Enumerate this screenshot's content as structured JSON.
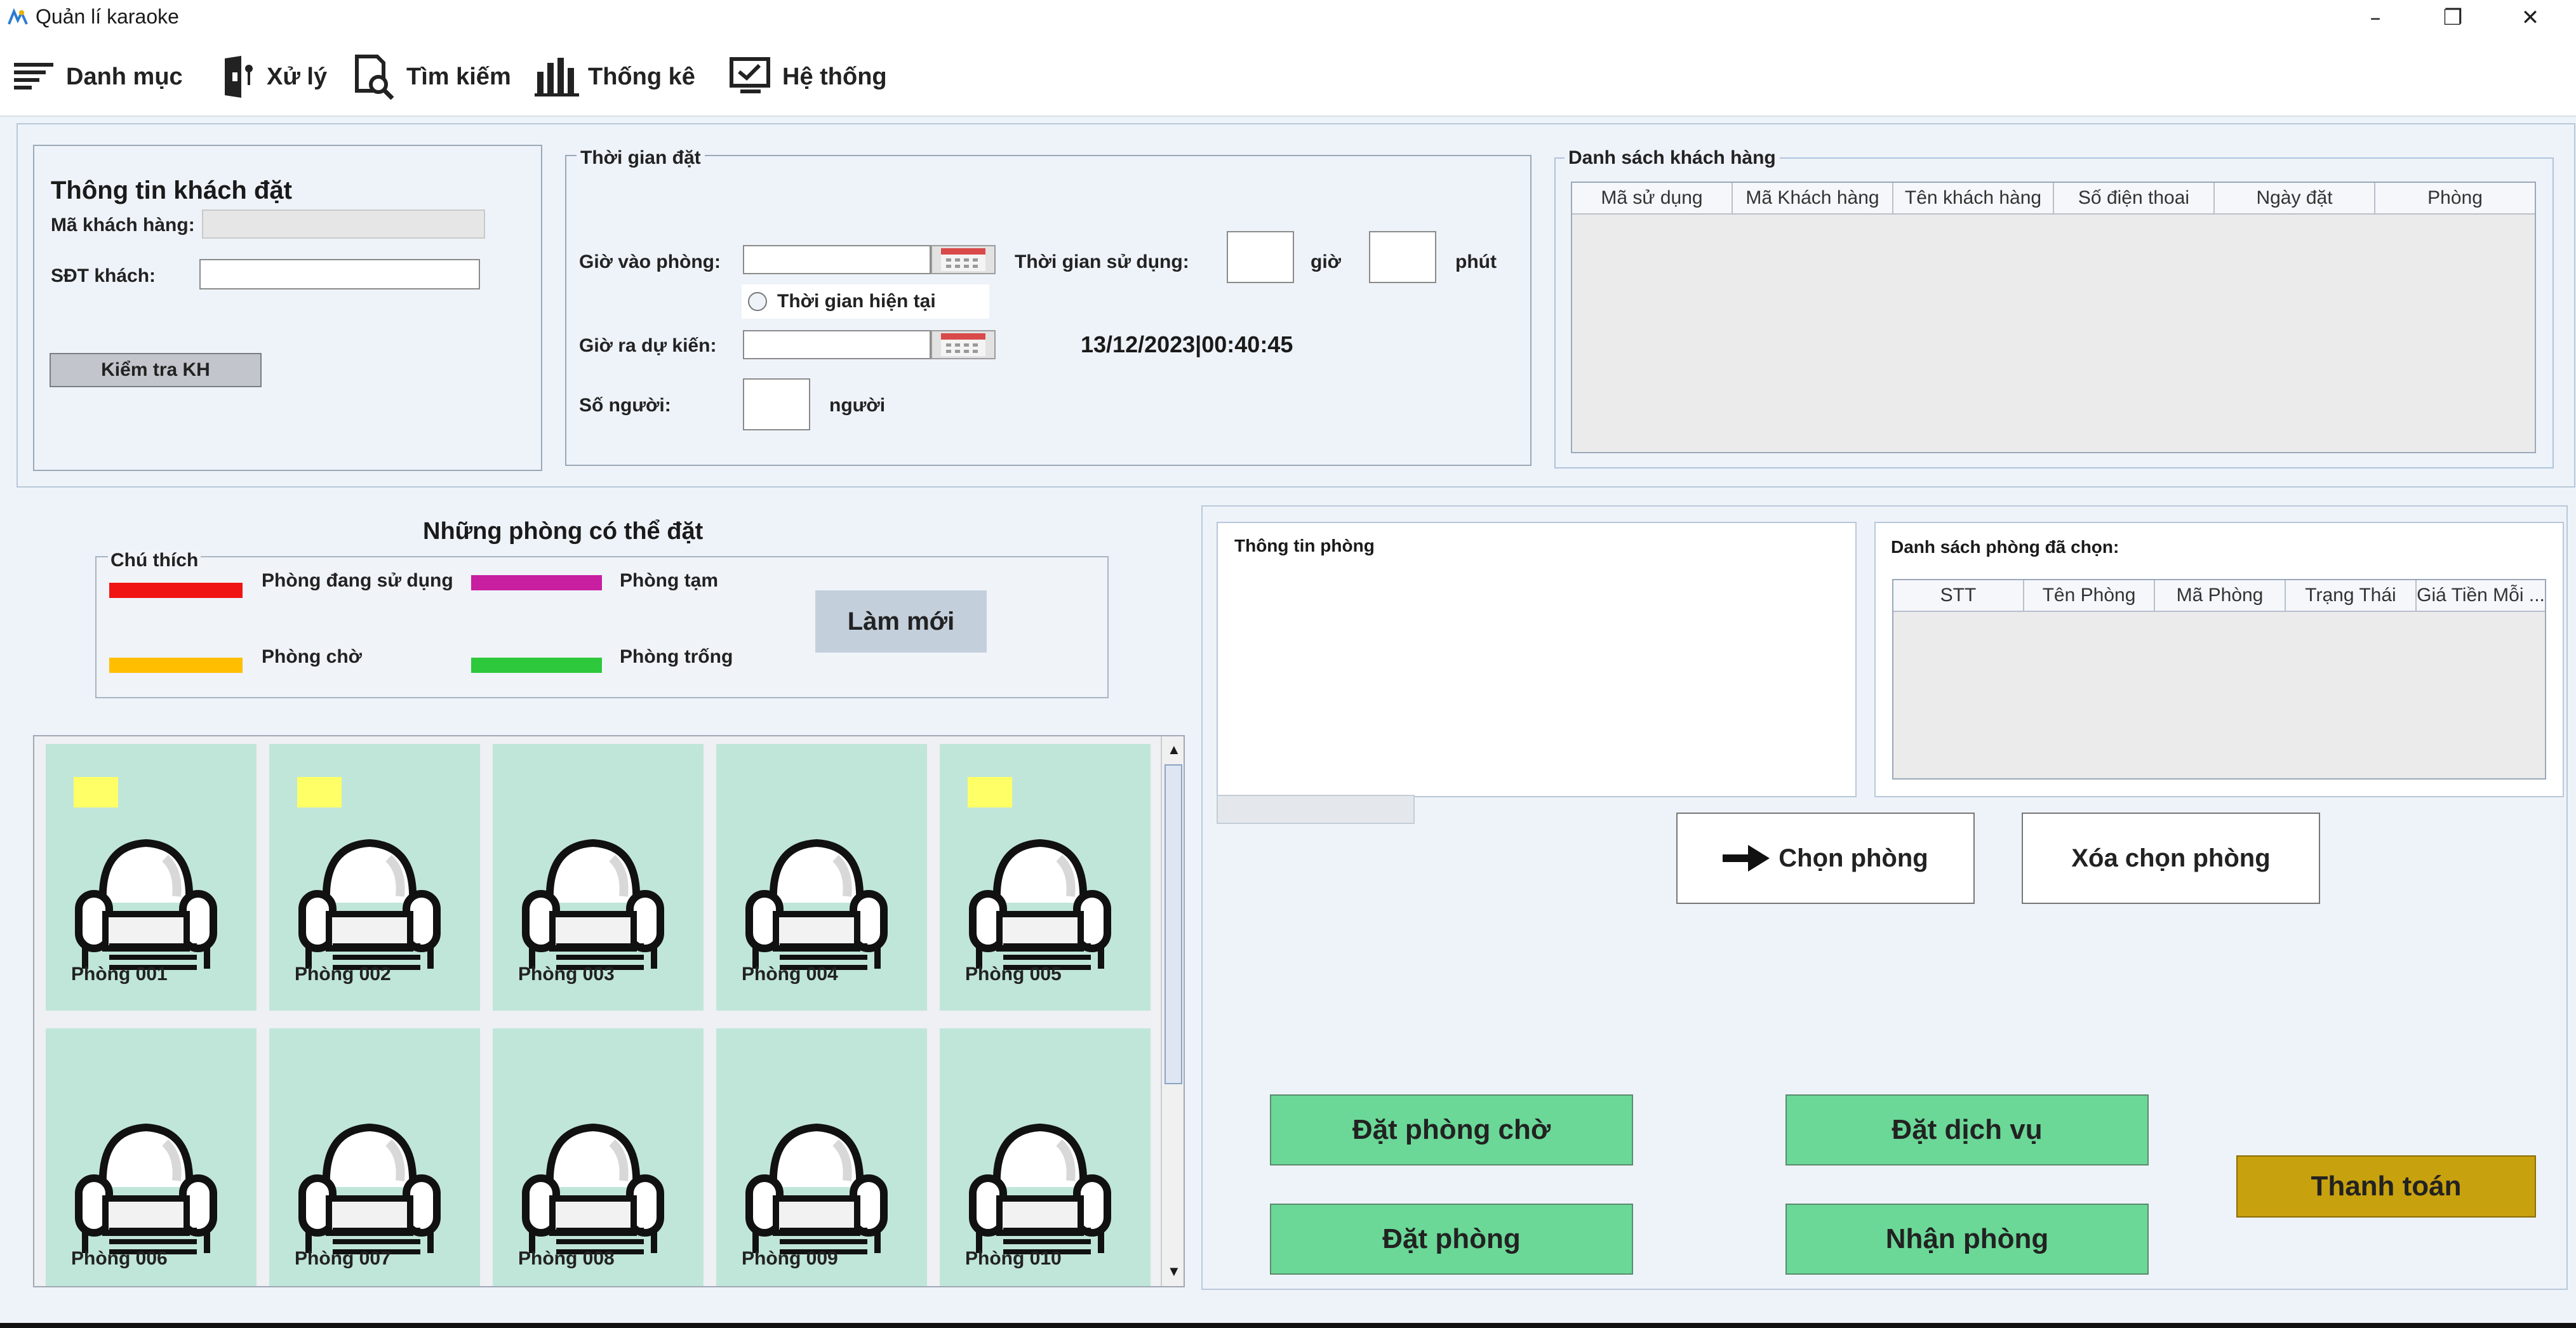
{
  "window": {
    "title": "Quản lí karaoke"
  },
  "menu": {
    "items": [
      {
        "label": "Danh mục",
        "icon": "list-icon"
      },
      {
        "label": "Xử lý",
        "icon": "door-key-icon"
      },
      {
        "label": "Tìm kiếm",
        "icon": "search-document-icon"
      },
      {
        "label": "Thống kê",
        "icon": "bar-chart-icon"
      },
      {
        "label": "Hệ thống",
        "icon": "monitor-check-icon"
      }
    ]
  },
  "customer": {
    "title": "Thông tin khách đặt",
    "id_label": "Mã khách hàng:",
    "id_value": "",
    "phone_label": "SĐT khách:",
    "phone_value": "",
    "check_button": "Kiểm tra KH"
  },
  "booking_time": {
    "legend": "Thời gian đặt",
    "checkin_label": "Giờ vào phòng:",
    "checkin_value": "",
    "current_time_radio": "Thời gian hiện tại",
    "checkout_label": "Giờ ra dự kiến:",
    "checkout_value": "",
    "duration_label": "Thời gian sử dụng:",
    "hours_value": "",
    "hours_unit": "giờ",
    "minutes_value": "",
    "minutes_unit": "phút",
    "clock": "13/12/2023|00:40:45",
    "people_label": "Số người:",
    "people_value": "",
    "people_unit": "người"
  },
  "customer_list": {
    "legend": "Danh sách khách hàng",
    "columns": [
      "Mã sử dụng",
      "Mã Khách hàng",
      "Tên khách hàng",
      "Số điện thoai",
      "Ngày đặt",
      "Phòng"
    ]
  },
  "available_rooms": {
    "title": "Những phòng có thể đặt",
    "legend_title": "Chú thích",
    "legend": [
      {
        "label": "Phòng đang sử dụng",
        "color": "#f01414"
      },
      {
        "label": "Phòng tạm",
        "color": "#c81ea0"
      },
      {
        "label": "Phòng chờ",
        "color": "#ffbe00"
      },
      {
        "label": "Phòng trống",
        "color": "#2dc83c"
      }
    ],
    "refresh_button": "Làm mới"
  },
  "rooms": [
    {
      "name": "Phòng 001",
      "vip": true
    },
    {
      "name": "Phòng 002",
      "vip": true
    },
    {
      "name": "Phòng 003",
      "vip": false
    },
    {
      "name": "Phòng 004",
      "vip": false
    },
    {
      "name": "Phòng 005",
      "vip": true
    },
    {
      "name": "Phòng 006",
      "vip": false
    },
    {
      "name": "Phòng 007",
      "vip": false
    },
    {
      "name": "Phòng 008",
      "vip": false
    },
    {
      "name": "Phòng 009",
      "vip": false
    },
    {
      "name": "Phòng 010",
      "vip": false
    }
  ],
  "room_info": {
    "title": "Thông tin phòng"
  },
  "selected_rooms": {
    "title": "Danh sách phòng đã chọn:",
    "columns": [
      "STT",
      "Tên Phòng",
      "Mã Phòng",
      "Trạng Thái",
      "Giá Tiền Mỗi ..."
    ]
  },
  "actions": {
    "choose_room": "Chọn phòng",
    "clear_selection": "Xóa chọn phòng",
    "book_waiting": "Đặt phòng chờ",
    "book_service": "Đặt dịch vụ",
    "book_room": "Đặt phòng",
    "receive_room": "Nhận phòng",
    "checkout": "Thanh toán"
  },
  "colors": {
    "accent_green": "#6bd897",
    "checkout_gold": "#c8a10e",
    "room_bg": "#c0e6d9",
    "vip_badge": "#ffff66"
  }
}
